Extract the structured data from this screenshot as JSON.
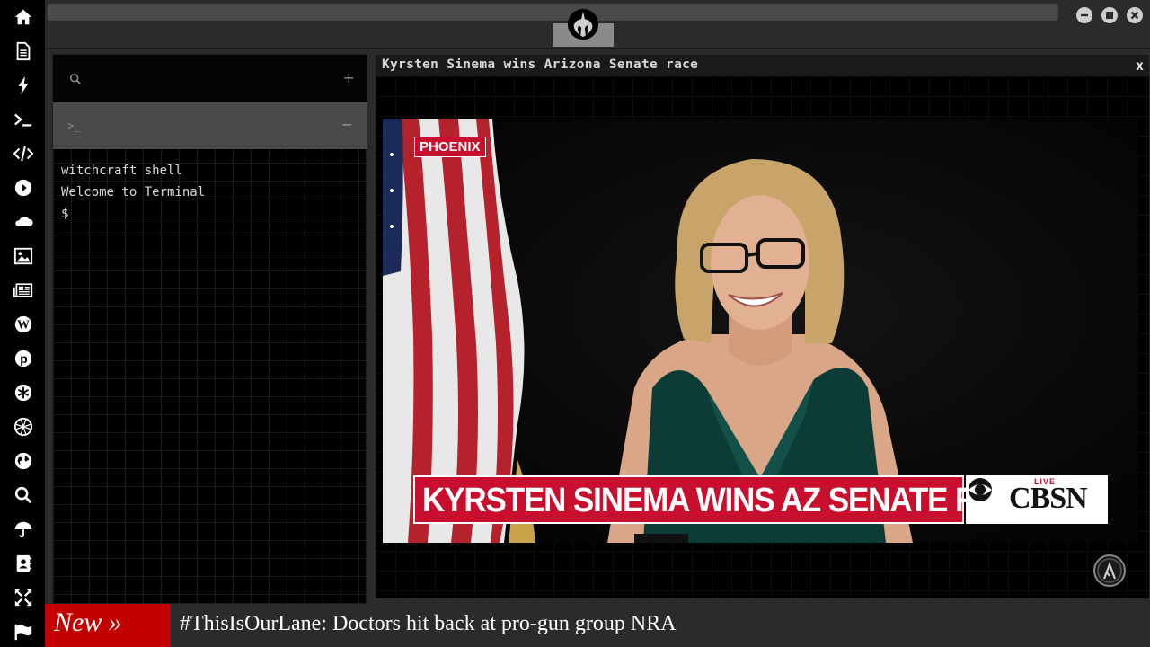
{
  "sidebar": {
    "items": [
      {
        "name": "home-icon"
      },
      {
        "name": "document-icon"
      },
      {
        "name": "lightning-icon"
      },
      {
        "name": "terminal-icon"
      },
      {
        "name": "code-icon"
      },
      {
        "name": "play-icon"
      },
      {
        "name": "cloud-icon"
      },
      {
        "name": "image-icon"
      },
      {
        "name": "newspaper-icon"
      },
      {
        "name": "wordpress-icon"
      },
      {
        "name": "pinterest-icon"
      },
      {
        "name": "asterisk-icon"
      },
      {
        "name": "globe-wire-icon"
      },
      {
        "name": "globe-icon"
      },
      {
        "name": "search-icon"
      },
      {
        "name": "umbrella-icon"
      },
      {
        "name": "contacts-icon"
      },
      {
        "name": "expand-icon"
      },
      {
        "name": "flag-icon"
      }
    ]
  },
  "topbar": {
    "address_value": "",
    "logo": "rebel-alliance-icon",
    "window_controls": [
      "minimize-icon",
      "maximize-icon",
      "close-icon"
    ]
  },
  "terminal": {
    "search_placeholder": "",
    "add_label": "+",
    "tab_prompt": ">_",
    "collapse_label": "−",
    "lines": [
      "witchcraft shell",
      "Welcome to Terminal",
      "$"
    ]
  },
  "video": {
    "title": "Kyrsten Sinema wins Arizona Senate race",
    "close_label": "x",
    "location_badge": "PHOENIX",
    "chyron": "KYRSTEN SINEMA WINS AZ SENATE RACE",
    "live_tag": "LIVE",
    "network": "CBSN",
    "corner_logo": "half-life-lambda-icon"
  },
  "ticker": {
    "badge": "New »",
    "headline": "#ThisIsOurLane: Doctors hit back at pro-gun group NRA"
  },
  "colors": {
    "chyron_red": "#c8102e",
    "ticker_red": "#c30000",
    "rail_bg": "#000000",
    "chrome_bg": "#2b2b2b"
  }
}
